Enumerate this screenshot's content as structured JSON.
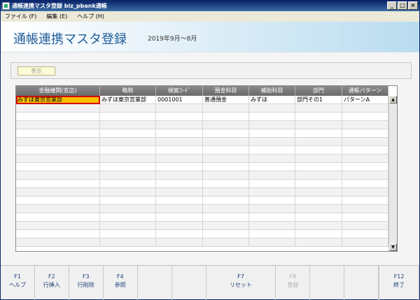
{
  "window": {
    "title": "通帳連携マスタ登録 biz_pbank通帳",
    "controls": [
      "_",
      "□",
      "×"
    ]
  },
  "menu": [
    {
      "label": "ファイル (F)"
    },
    {
      "label": "編集 (E)"
    },
    {
      "label": "ヘルプ (H)"
    }
  ],
  "header": {
    "title": "通帳連携マスタ登録",
    "period": "2019年9月～8月"
  },
  "filter": {
    "show_label": "表示"
  },
  "table": {
    "columns": [
      "金融機関(支店)",
      "略称",
      "検索ｺｰﾄﾞ",
      "預金科目",
      "補助科目",
      "部門",
      "通帳パターン"
    ],
    "rows": [
      [
        "みずほ東京営業部",
        "みずほ東京営業部",
        "0001001",
        "普通預金",
        "みずほ",
        "部門その1",
        "パターンA"
      ]
    ],
    "empty_rows": 17
  },
  "scrollbar": {
    "up": "▲",
    "down": "▼"
  },
  "fkeys": [
    {
      "key": "F1",
      "label": "ヘルプ",
      "enabled": true
    },
    {
      "key": "F2",
      "label": "行挿入",
      "enabled": true
    },
    {
      "key": "F3",
      "label": "行削除",
      "enabled": true
    },
    {
      "key": "F4",
      "label": "参照",
      "enabled": true
    },
    {
      "key": "",
      "label": "",
      "enabled": false
    },
    {
      "key": "",
      "label": "",
      "enabled": false
    },
    {
      "key": "F7",
      "label": "リセット",
      "enabled": true
    },
    {
      "key": "F8",
      "label": "登録",
      "enabled": false
    },
    {
      "key": "",
      "label": "",
      "enabled": false
    },
    {
      "key": "",
      "label": "",
      "enabled": false
    },
    {
      "key": "",
      "label": "",
      "enabled": false
    },
    {
      "key": "F12",
      "label": "終了",
      "enabled": true
    }
  ]
}
